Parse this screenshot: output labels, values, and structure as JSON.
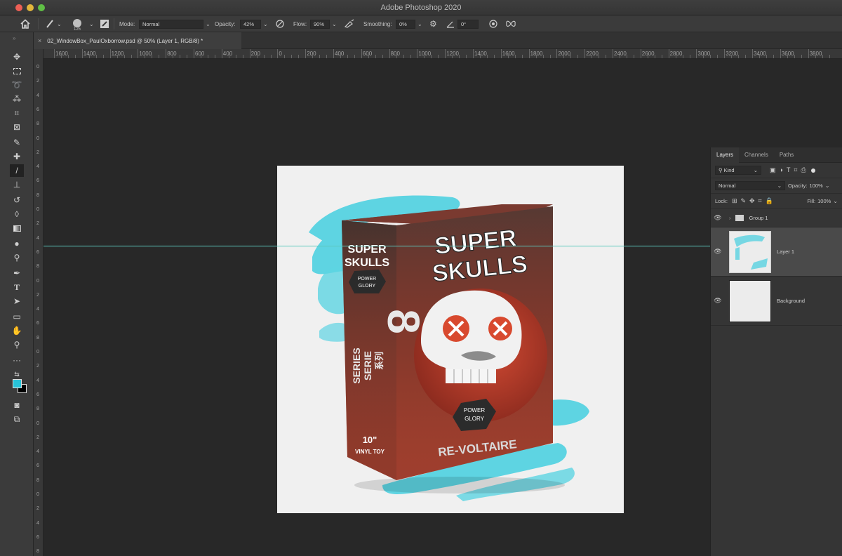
{
  "app": {
    "title": "Adobe Photoshop 2020"
  },
  "options_bar": {
    "brush_size": "125",
    "mode_label": "Mode:",
    "mode_value": "Normal",
    "opacity_label": "Opacity:",
    "opacity_value": "42%",
    "flow_label": "Flow:",
    "flow_value": "90%",
    "smoothing_label": "Smoothing:",
    "smoothing_value": "0%",
    "angle_value": "0°"
  },
  "document": {
    "tab_close": "×",
    "tab_label": "02_WindowBox_PaulOxborrow.psd @ 50% (Layer 1, RGB/8) *"
  },
  "ruler": {
    "horizontal": [
      "1600",
      "1400",
      "1200",
      "1000",
      "800",
      "600",
      "400",
      "200",
      "0",
      "200",
      "400",
      "600",
      "800",
      "1000",
      "1200",
      "1400",
      "1600",
      "1800",
      "2000",
      "2200",
      "2400",
      "2600",
      "2800",
      "3000",
      "3200",
      "3400",
      "3600",
      "3800"
    ],
    "vertical": [
      "0",
      "2",
      "4",
      "6",
      "8",
      "0",
      "2",
      "4",
      "6",
      "8",
      "0",
      "2",
      "4",
      "6",
      "8",
      "0",
      "2",
      "4",
      "6",
      "8",
      "0",
      "2",
      "4",
      "6",
      "8",
      "0",
      "2",
      "4",
      "6",
      "8",
      "0",
      "2",
      "4",
      "6",
      "8"
    ]
  },
  "artwork": {
    "title_line1": "SUPER",
    "title_line2": "SKULLS",
    "side_title1": "SUPER",
    "side_title2": "SKULLS",
    "badge_line1": "POWER",
    "badge_line2": "GLORY",
    "side_badge_line1": "POWER",
    "side_badge_line2": "GLORY",
    "series_number": "8",
    "series_label1": "SERIES",
    "series_label2": "SERIE",
    "series_cjk": "系列",
    "size": "10\"",
    "size_label": "VINYL TOY",
    "character_name": "RE-VOLTAIRE"
  },
  "layers_panel": {
    "tabs": [
      "Layers",
      "Channels",
      "Paths"
    ],
    "filter_kind": "Kind",
    "blend_mode": "Normal",
    "opacity_label": "Opacity:",
    "opacity_value": "100%",
    "lock_label": "Lock:",
    "fill_label": "Fill:",
    "fill_value": "100%",
    "layers": [
      {
        "name": "Group 1"
      },
      {
        "name": "Layer 1"
      },
      {
        "name": "Background"
      }
    ]
  },
  "colors": {
    "foreground": "#27c3d8",
    "background": "#000000",
    "guide": "#5cc8bd",
    "brush_stroke": "#44cfe0",
    "box_red": "#8a3428"
  }
}
